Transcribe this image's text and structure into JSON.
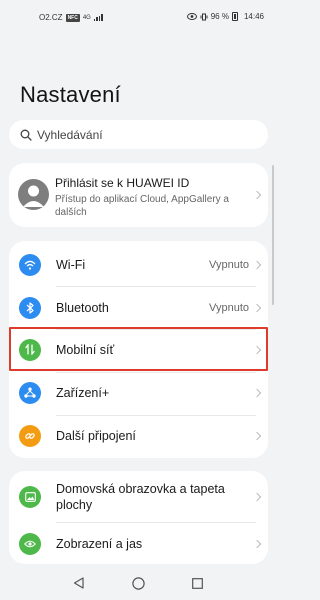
{
  "status": {
    "carrier": "O2.CZ",
    "nfc": "NFC",
    "network": "4G",
    "battery": "96 %",
    "time": "14:46"
  },
  "page": {
    "title": "Nastavení"
  },
  "search": {
    "placeholder": "Vyhledávání"
  },
  "account": {
    "title": "Přihlásit se k HUAWEI ID",
    "subtitle": "Přístup do aplikací Cloud, AppGallery a dalších"
  },
  "connectivity": [
    {
      "label": "Wi-Fi",
      "value": "Vypnuto",
      "icon": "wifi-icon",
      "color": "#2d8cf0"
    },
    {
      "label": "Bluetooth",
      "value": "Vypnuto",
      "icon": "bluetooth-icon",
      "color": "#2d8cf0"
    },
    {
      "label": "Mobilní síť",
      "value": "",
      "icon": "mobile-data-icon",
      "color": "#4fb84a"
    },
    {
      "label": "Zařízení+",
      "value": "",
      "icon": "device-plus-icon",
      "color": "#2d8cf0"
    },
    {
      "label": "Další připojení",
      "value": "",
      "icon": "link-icon",
      "color": "#f39c12"
    }
  ],
  "display": [
    {
      "label": "Domovská obrazovka a tapeta plochy",
      "icon": "wallpaper-icon",
      "color": "#4fb84a"
    },
    {
      "label": "Zobrazení a jas",
      "icon": "eye-icon",
      "color": "#4fb84a"
    }
  ]
}
